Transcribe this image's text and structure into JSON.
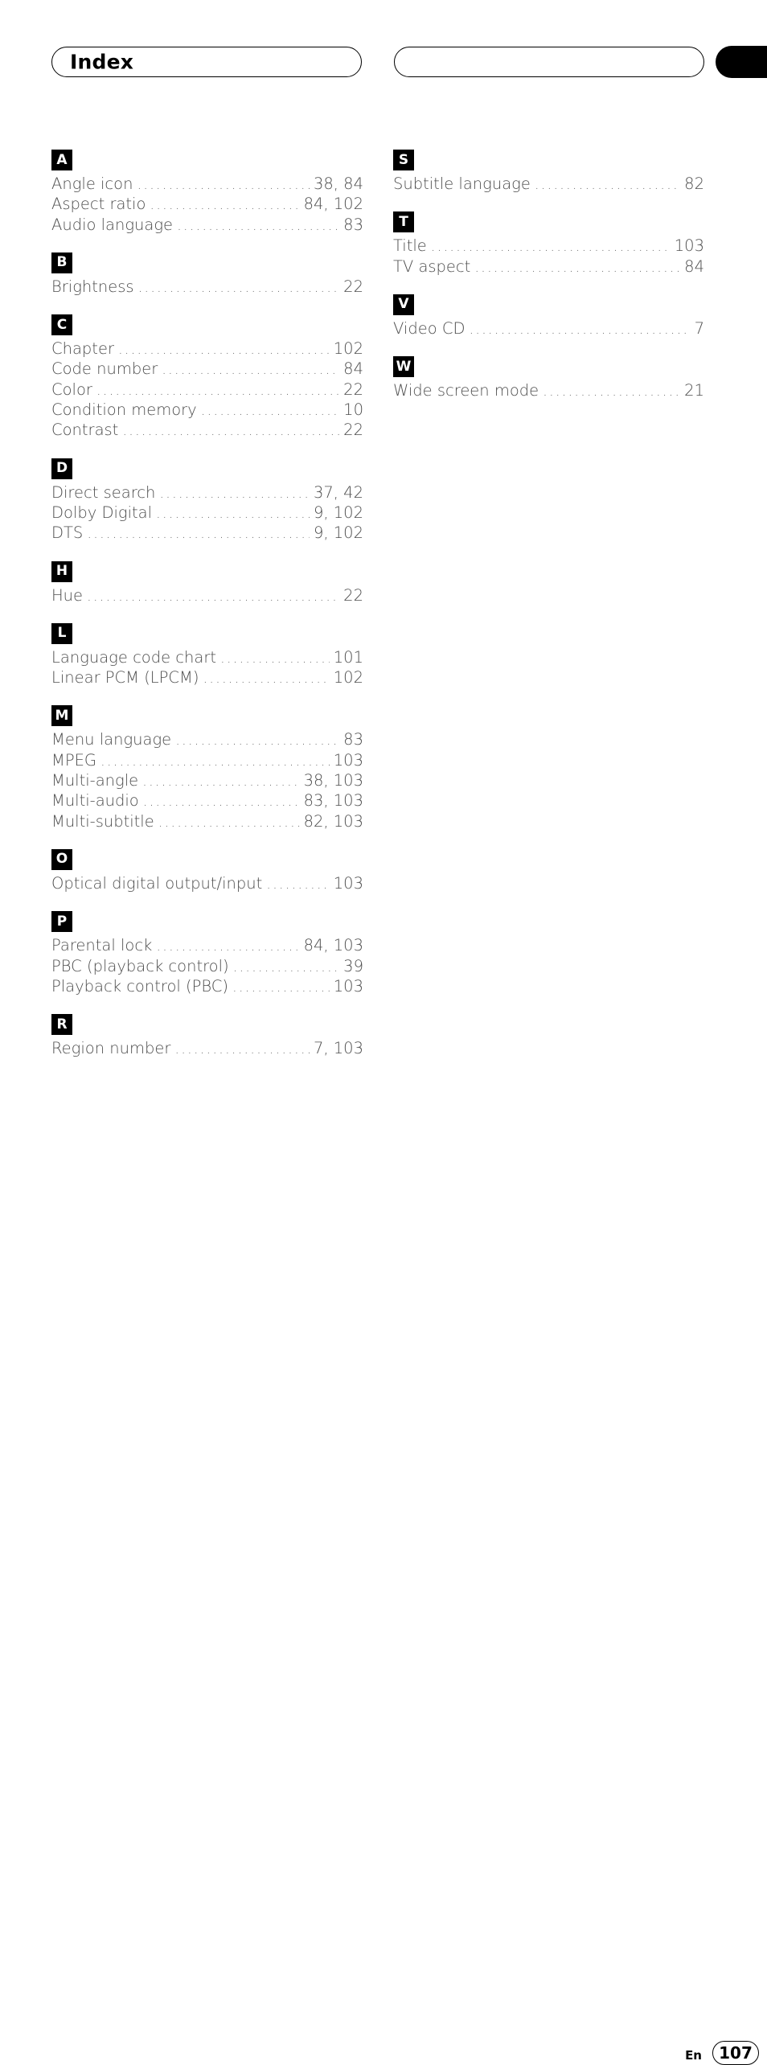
{
  "header": {
    "title": "Index",
    "right_pill_text": "",
    "thumb_tab": "black-thumb-tab"
  },
  "footer": {
    "language_code": "En",
    "page_number": "107"
  },
  "dot_leader": "...........................................................................................................",
  "columns": {
    "left": [
      {
        "letter": "A",
        "entries": [
          {
            "label": "Angle icon",
            "page": "38, 84"
          },
          {
            "label": "Aspect ratio",
            "page": "84, 102"
          },
          {
            "label": "Audio language",
            "page": "83"
          }
        ]
      },
      {
        "letter": "B",
        "entries": [
          {
            "label": "Brightness",
            "page": "22"
          }
        ]
      },
      {
        "letter": "C",
        "entries": [
          {
            "label": "Chapter",
            "page": "102"
          },
          {
            "label": "Code number",
            "page": "84"
          },
          {
            "label": "Color",
            "page": "22"
          },
          {
            "label": "Condition memory",
            "page": "10"
          },
          {
            "label": "Contrast",
            "page": "22"
          }
        ]
      },
      {
        "letter": "D",
        "entries": [
          {
            "label": "Direct search",
            "page": "37, 42"
          },
          {
            "label": "Dolby Digital",
            "page": "9, 102"
          },
          {
            "label": "DTS",
            "page": "9, 102"
          }
        ]
      },
      {
        "letter": "H",
        "entries": [
          {
            "label": "Hue",
            "page": "22"
          }
        ]
      },
      {
        "letter": "L",
        "entries": [
          {
            "label": "Language code chart",
            "page": "101"
          },
          {
            "label": "Linear PCM (LPCM)",
            "page": "102"
          }
        ]
      },
      {
        "letter": "M",
        "entries": [
          {
            "label": "Menu language",
            "page": "83"
          },
          {
            "label": "MPEG",
            "page": "103"
          },
          {
            "label": "Multi-angle",
            "page": "38, 103"
          },
          {
            "label": "Multi-audio",
            "page": "83, 103"
          },
          {
            "label": "Multi-subtitle",
            "page": "82, 103"
          }
        ]
      },
      {
        "letter": "O",
        "entries": [
          {
            "label": "Optical digital output/input",
            "page": "103"
          }
        ]
      },
      {
        "letter": "P",
        "entries": [
          {
            "label": "Parental lock",
            "page": "84, 103"
          },
          {
            "label": "PBC (playback control)",
            "page": "39"
          },
          {
            "label": "Playback control (PBC)",
            "page": "103"
          }
        ]
      },
      {
        "letter": "R",
        "entries": [
          {
            "label": "Region number",
            "page": "7, 103"
          }
        ]
      }
    ],
    "right": [
      {
        "letter": "S",
        "entries": [
          {
            "label": "Subtitle language",
            "page": "82"
          }
        ]
      },
      {
        "letter": "T",
        "entries": [
          {
            "label": "Title",
            "page": "103"
          },
          {
            "label": "TV aspect",
            "page": "84"
          }
        ]
      },
      {
        "letter": "V",
        "entries": [
          {
            "label": "Video CD",
            "page": "7"
          }
        ]
      },
      {
        "letter": "W",
        "entries": [
          {
            "label": "Wide screen mode",
            "page": "21"
          }
        ]
      }
    ]
  }
}
